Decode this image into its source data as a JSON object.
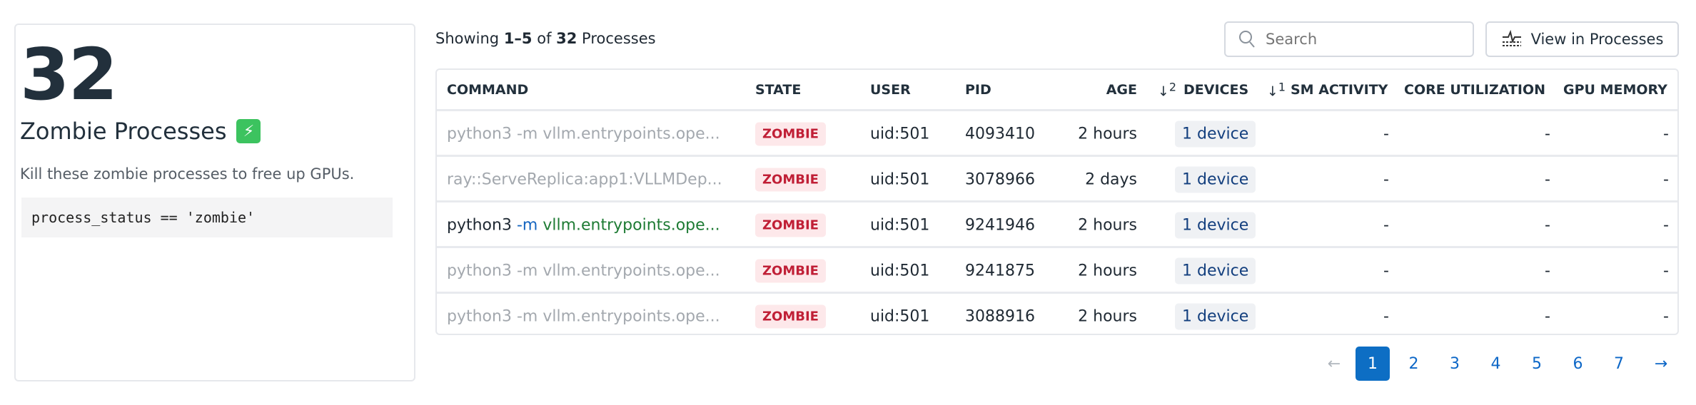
{
  "card": {
    "count": "32",
    "title": "Zombie Processes",
    "description": "Kill these zombie processes to free up GPUs.",
    "query": "process_status == 'zombie'"
  },
  "toolbar": {
    "showing_prefix": "Showing ",
    "range": "1–5",
    "of": " of ",
    "total": "32",
    "suffix": " Processes",
    "search_placeholder": "Search",
    "view_button": "View in Processes"
  },
  "columns": {
    "command": "COMMAND",
    "state": "STATE",
    "user": "USER",
    "pid": "PID",
    "age": "AGE",
    "devices": "DEVICES",
    "devices_sort": "2",
    "sm": "SM ACTIVITY",
    "sm_sort": "1",
    "core": "CORE UTILIZATION",
    "gpu": "GPU MEMORY"
  },
  "rows": [
    {
      "cmd_a": "python3",
      "cmd_b": " -m ",
      "cmd_c": "vllm.entrypoints.ope...",
      "state": "ZOMBIE",
      "user": "uid:501",
      "pid": "4093410",
      "age": "2 hours",
      "devices": "1 device",
      "sm": "-",
      "core": "-",
      "gpu": "-",
      "muted": true
    },
    {
      "cmd_a": "ray::ServeReplica:app1:VLLMDep...",
      "cmd_b": "",
      "cmd_c": "",
      "state": "ZOMBIE",
      "user": "uid:501",
      "pid": "3078966",
      "age": "2 days",
      "devices": "1 device",
      "sm": "-",
      "core": "-",
      "gpu": "-",
      "muted": true
    },
    {
      "cmd_a": "python3",
      "cmd_b": " -m ",
      "cmd_c": "vllm.entrypoints.ope...",
      "state": "ZOMBIE",
      "user": "uid:501",
      "pid": "9241946",
      "age": "2 hours",
      "devices": "1 device",
      "sm": "-",
      "core": "-",
      "gpu": "-",
      "muted": false
    },
    {
      "cmd_a": "python3",
      "cmd_b": " -m ",
      "cmd_c": "vllm.entrypoints.ope...",
      "state": "ZOMBIE",
      "user": "uid:501",
      "pid": "9241875",
      "age": "2 hours",
      "devices": "1 device",
      "sm": "-",
      "core": "-",
      "gpu": "-",
      "muted": true
    },
    {
      "cmd_a": "python3",
      "cmd_b": " -m ",
      "cmd_c": "vllm.entrypoints.ope...",
      "state": "ZOMBIE",
      "user": "uid:501",
      "pid": "3088916",
      "age": "2 hours",
      "devices": "1 device",
      "sm": "-",
      "core": "-",
      "gpu": "-",
      "muted": true
    }
  ],
  "pagination": {
    "prev": "←",
    "next": "→",
    "pages": [
      "1",
      "2",
      "3",
      "4",
      "5",
      "6",
      "7"
    ],
    "current": "1"
  }
}
